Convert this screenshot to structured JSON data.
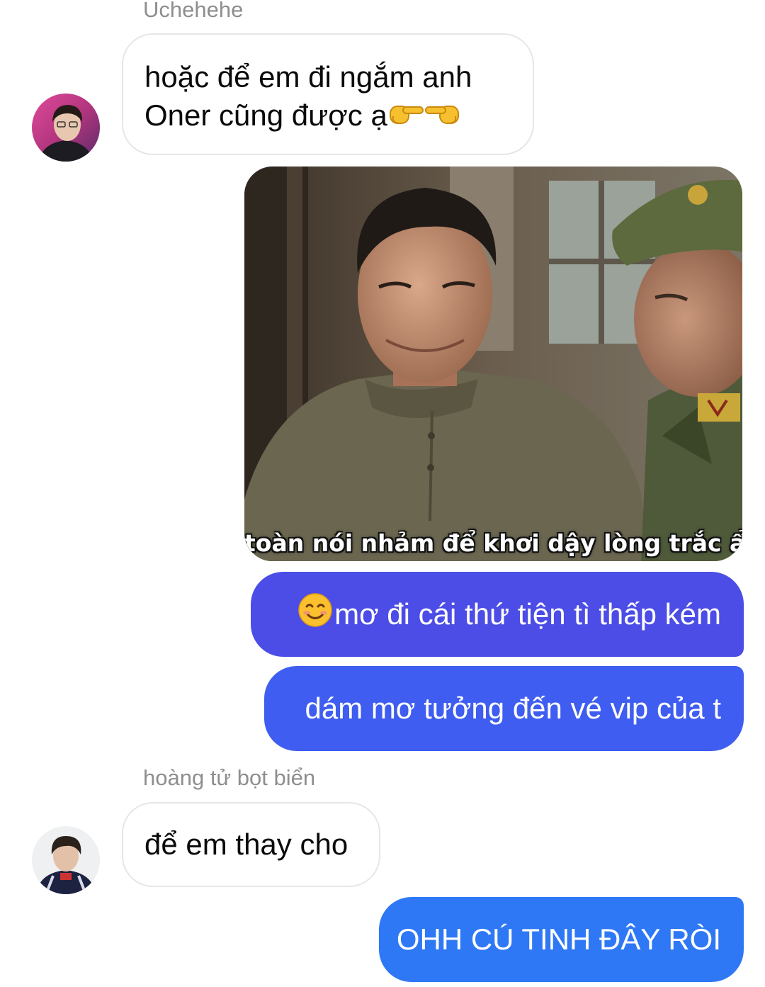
{
  "messages": [
    {
      "sender": "Uchehehe",
      "lines": [
        "hoặc để em đi ngắm anh",
        "Oner cũng được ạ"
      ],
      "emoji": [
        "pointing-right-icon",
        "pointing-left-icon"
      ]
    },
    {
      "image_caption": "toàn nói nhảm để khơi dậy lòng trắc ẩn."
    },
    {
      "text": "mơ đi cái thứ tiện tì thấp kém",
      "emoji": "smiling-face-icon"
    },
    {
      "text": "dám mơ tưởng đến vé vip của t"
    },
    {
      "sender": "hoàng tử bọt biển",
      "text": "để em thay cho"
    },
    {
      "text": "OHH CÚ TINH ĐÂY RÒI"
    }
  ],
  "colors": {
    "outgoing_purple": "#4c4ce6",
    "outgoing_indigo": "#3f5df0",
    "outgoing_blue": "#2f78f5",
    "incoming_border": "#e6e6ea",
    "name_gray": "#8e8e8e"
  }
}
